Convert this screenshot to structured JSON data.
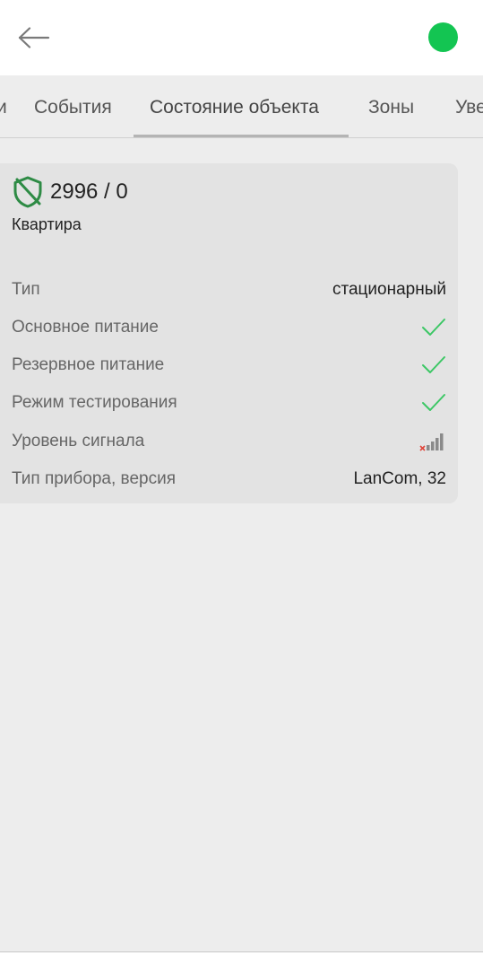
{
  "colors": {
    "status_online": "#13c552",
    "shield": "#2e8b45",
    "check": "#3cc765",
    "signal_bars": "#8a8a8a",
    "signal_cross": "#e0453a"
  },
  "appbar": {
    "back_icon": "arrow-left-icon",
    "status": "online"
  },
  "tabs": [
    {
      "label": "и"
    },
    {
      "label": "События"
    },
    {
      "label": "Состояние объекта",
      "active": true
    },
    {
      "label": "Зоны"
    },
    {
      "label": "Уве"
    }
  ],
  "card": {
    "icon": "shield-icon",
    "number": "2996 / 0",
    "name": "Квартира",
    "rows": [
      {
        "label": "Тип",
        "value": "стационарный"
      },
      {
        "label": "Основное питание",
        "icon": "check-icon"
      },
      {
        "label": "Резервное питание",
        "icon": "check-icon"
      },
      {
        "label": "Режим тестирования",
        "icon": "check-icon"
      },
      {
        "label": "Уровень сигнала",
        "icon": "signal-no-connection-icon"
      },
      {
        "label": "Тип прибора, версия",
        "value": "LanCom, 32"
      }
    ]
  }
}
